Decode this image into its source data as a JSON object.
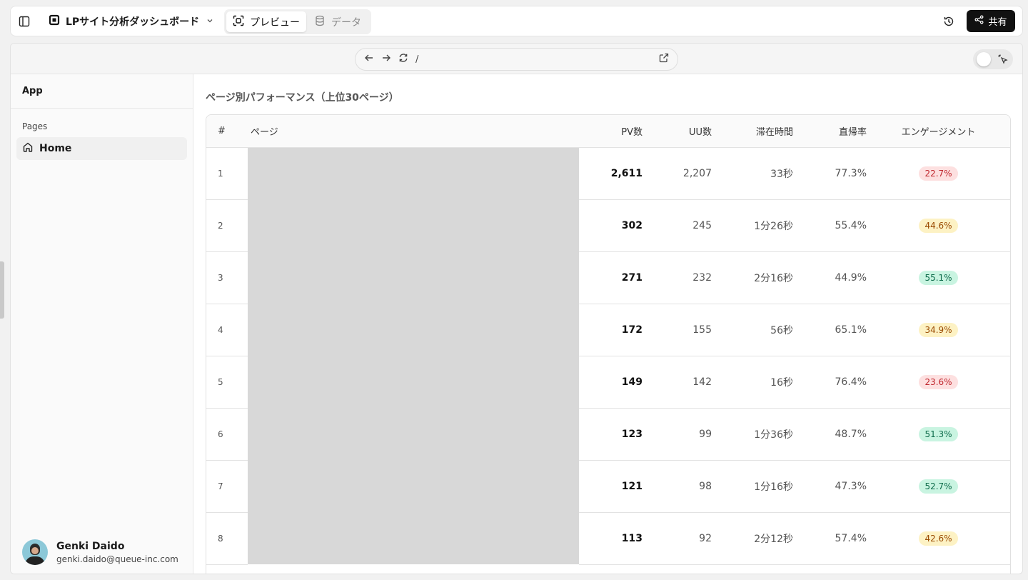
{
  "topbar": {
    "project_name": "LPサイト分析ダッシュボード",
    "tabs": [
      {
        "label": "プレビュー",
        "icon": "scan-icon",
        "active": true
      },
      {
        "label": "データ",
        "icon": "database-icon",
        "active": false
      }
    ],
    "share_label": "共有"
  },
  "browser": {
    "url": "/"
  },
  "sidebar": {
    "app_title": "App",
    "section_label": "Pages",
    "items": [
      {
        "label": "Home",
        "icon": "home-icon"
      }
    ],
    "user": {
      "name": "Genki Daido",
      "email": "genki.daido@queue-inc.com"
    }
  },
  "main": {
    "title": "ページ別パフォーマンス（上位30ページ）",
    "columns": [
      "#",
      "ページ",
      "PV数",
      "UU数",
      "滞在時間",
      "直帰率",
      "エンゲージメント"
    ],
    "rows": [
      {
        "rank": "1",
        "pv": "2,611",
        "uu": "2,207",
        "time": "33秒",
        "bounce": "77.3%",
        "engagement": "22.7%",
        "level": "red"
      },
      {
        "rank": "2",
        "pv": "302",
        "uu": "245",
        "time": "1分26秒",
        "bounce": "55.4%",
        "engagement": "44.6%",
        "level": "yellow"
      },
      {
        "rank": "3",
        "pv": "271",
        "uu": "232",
        "time": "2分16秒",
        "bounce": "44.9%",
        "engagement": "55.1%",
        "level": "green"
      },
      {
        "rank": "4",
        "pv": "172",
        "uu": "155",
        "time": "56秒",
        "bounce": "65.1%",
        "engagement": "34.9%",
        "level": "yellow"
      },
      {
        "rank": "5",
        "pv": "149",
        "uu": "142",
        "time": "16秒",
        "bounce": "76.4%",
        "engagement": "23.6%",
        "level": "red"
      },
      {
        "rank": "6",
        "pv": "123",
        "uu": "99",
        "time": "1分36秒",
        "bounce": "48.7%",
        "engagement": "51.3%",
        "level": "green"
      },
      {
        "rank": "7",
        "pv": "121",
        "uu": "98",
        "time": "1分16秒",
        "bounce": "47.3%",
        "engagement": "52.7%",
        "level": "green"
      },
      {
        "rank": "8",
        "pv": "113",
        "uu": "92",
        "time": "2分12秒",
        "bounce": "57.4%",
        "engagement": "42.6%",
        "level": "yellow"
      }
    ]
  },
  "colors": {
    "badge_red_bg": "#fde0e0",
    "badge_yellow_bg": "#fdf2c4",
    "badge_green_bg": "#c9f4e1",
    "share_button_bg": "#111111",
    "redacted_cell": "#d8d8d8"
  }
}
